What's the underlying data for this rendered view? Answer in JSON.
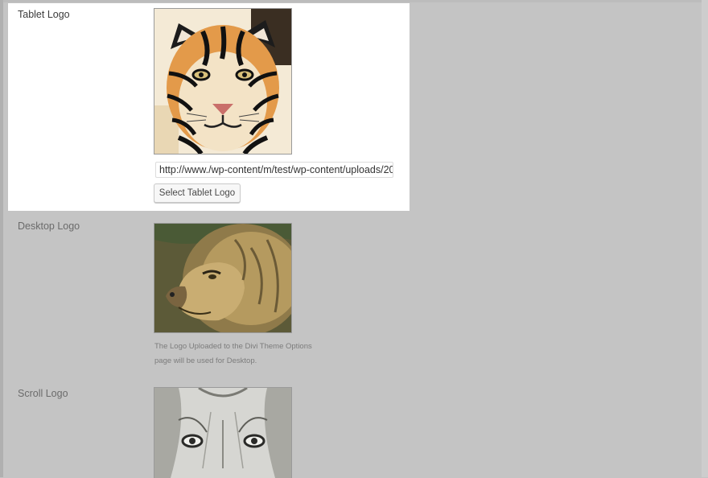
{
  "tablet_logo": {
    "label": "Tablet Logo",
    "image": "tiger-photo",
    "url_value": "http://www./wp-content/m/test/wp-content/uploads/20",
    "button_label": "Select Tablet Logo"
  },
  "desktop_logo": {
    "label": "Desktop Logo",
    "image": "lion-photo",
    "description_line1": "The Logo Uploaded to the Divi Theme Options",
    "description_line2": "page will be used for Desktop."
  },
  "scroll_logo": {
    "label": "Scroll Logo",
    "image": "lioness-photo"
  }
}
